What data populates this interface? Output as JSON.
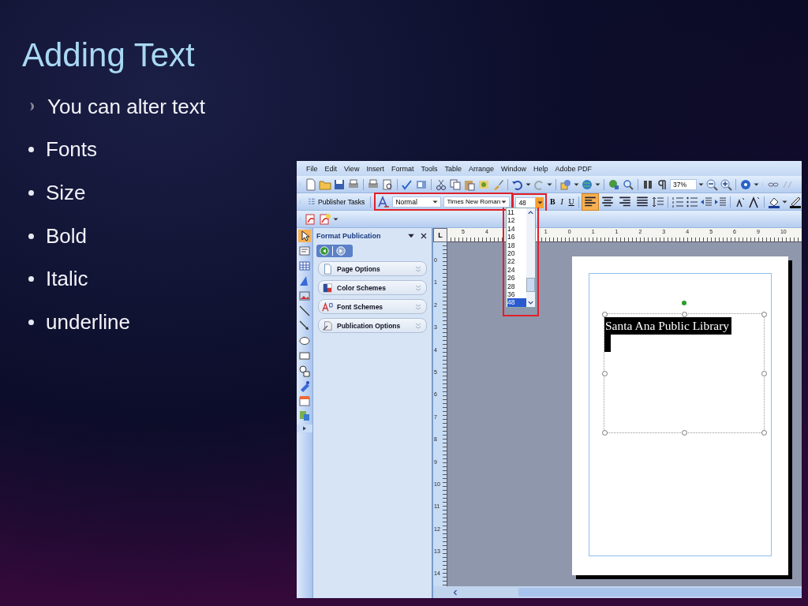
{
  "slide": {
    "title": "Adding Text",
    "bullets": [
      {
        "text": "You can alter text",
        "kind": "arrow"
      },
      {
        "text": "Fonts",
        "kind": "dot"
      },
      {
        "text": "Size",
        "kind": "dot"
      },
      {
        "text": "Bold",
        "kind": "dot"
      },
      {
        "text": "Italic",
        "kind": "dot"
      },
      {
        "text": "underline",
        "kind": "dot"
      }
    ]
  },
  "app": {
    "menu": [
      "File",
      "Edit",
      "View",
      "Insert",
      "Format",
      "Tools",
      "Table",
      "Arrange",
      "Window",
      "Help",
      "Adobe PDF"
    ],
    "standard_toolbar": {
      "zoom": "37%"
    },
    "formatting_toolbar": {
      "tasks_label": "Publisher Tasks",
      "style": "Normal",
      "font": "Times New Roman",
      "font_size": "48",
      "bold": "B",
      "italic": "I",
      "underline": "U",
      "align_buttons": [
        {
          "selected": true
        },
        {
          "selected": false
        },
        {
          "selected": false
        },
        {
          "selected": false
        }
      ]
    },
    "size_dropdown": {
      "options": [
        {
          "label": "11",
          "selected": false
        },
        {
          "label": "12",
          "selected": false
        },
        {
          "label": "14",
          "selected": false
        },
        {
          "label": "16",
          "selected": false
        },
        {
          "label": "18",
          "selected": false
        },
        {
          "label": "20",
          "selected": false
        },
        {
          "label": "22",
          "selected": false
        },
        {
          "label": "24",
          "selected": false
        },
        {
          "label": "26",
          "selected": false
        },
        {
          "label": "28",
          "selected": false
        },
        {
          "label": "36",
          "selected": false
        },
        {
          "label": "48",
          "selected": true
        }
      ]
    },
    "task_pane": {
      "title": "Format Publication",
      "items": [
        {
          "label": "Page Options",
          "kind": "page"
        },
        {
          "label": "Color Schemes",
          "kind": "color"
        },
        {
          "label": "Font Schemes",
          "kind": "font"
        },
        {
          "label": "Publication Options",
          "kind": "options"
        }
      ]
    },
    "rulers": {
      "corner": "L",
      "horizontal": [
        "5",
        "4",
        "1",
        "0",
        "1",
        "1",
        "2",
        "3",
        "4",
        "5",
        "6",
        "9",
        "10"
      ],
      "vertical": [
        "0",
        "1",
        "2",
        "3",
        "4",
        "5",
        "6",
        "7",
        "8",
        "9",
        "10",
        "11",
        "12",
        "13",
        "14"
      ]
    },
    "document": {
      "text": "Santa Ana Public Library"
    }
  }
}
